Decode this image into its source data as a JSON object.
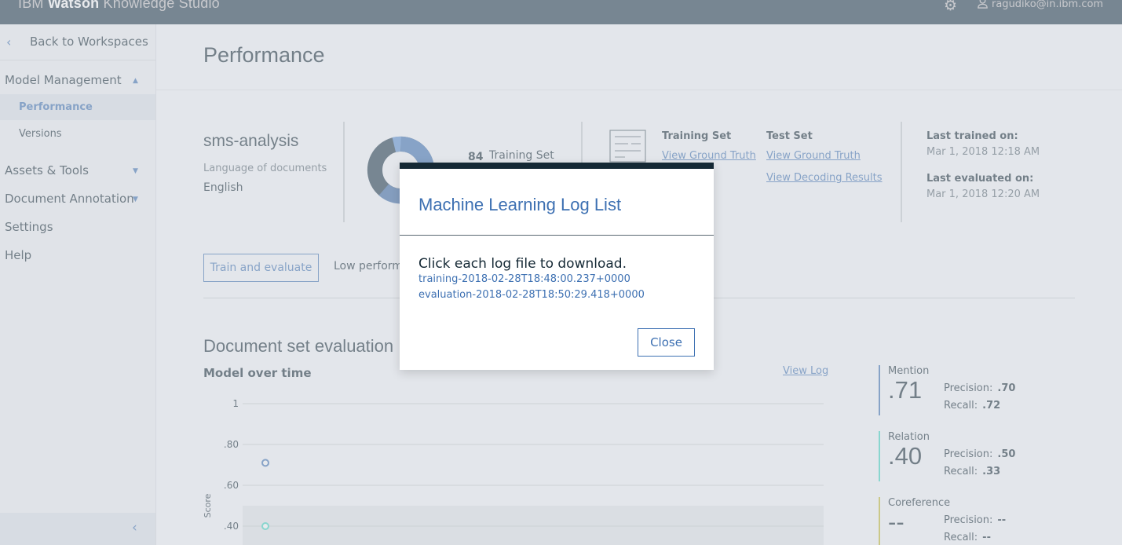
{
  "app": {
    "brand_prefix": "IBM ",
    "brand_bold": "Watson",
    "brand_suffix": " Knowledge Studio",
    "user": "ragudiko@in.ibm.com"
  },
  "sidebar": {
    "back_label": "Back to Workspaces",
    "model_management": "Model Management",
    "performance": "Performance",
    "versions": "Versions",
    "assets_tools": "Assets & Tools",
    "document_annotation": "Document Annotation",
    "settings": "Settings",
    "help": "Help"
  },
  "page": {
    "title": "Performance"
  },
  "project": {
    "name": "sms-analysis",
    "language_label": "Language of documents",
    "language": "English"
  },
  "summary": {
    "training_count": "84",
    "training_label": "Training Set"
  },
  "sets": {
    "training_title": "Training Set",
    "training_link": "View Ground Truth",
    "test_title": "Test Set",
    "test_link1": "View Ground Truth",
    "test_link2": "View Decoding Results"
  },
  "meta": {
    "last_trained_label": "Last trained on:",
    "last_trained_value": "Mar 1, 2018 12:18 AM",
    "last_evaluated_label": "Last evaluated on:",
    "last_evaluated_value": "Mar 1, 2018 12:20 AM"
  },
  "actions": {
    "train_button": "Train and evaluate",
    "low_perf_text": "Low performa"
  },
  "evaluation": {
    "section_title": "Document set evaluation",
    "chart_title": "Model over time",
    "view_log": "View Log"
  },
  "chart_data": {
    "type": "scatter",
    "title": "Model over time",
    "xlabel": "",
    "ylabel": "Score",
    "y_ticks": [
      "1",
      ".80",
      ".60",
      ".40"
    ],
    "ylim": [
      0.4,
      1
    ],
    "series": [
      {
        "name": "Mention",
        "x": [
          1
        ],
        "y": [
          0.71
        ],
        "color": "#3d70b2"
      },
      {
        "name": "Relation",
        "x": [
          1
        ],
        "y": [
          0.4
        ],
        "color": "#41d6c3"
      }
    ]
  },
  "metrics": [
    {
      "name": "Mention",
      "value": ".71",
      "precision": ".70",
      "recall": ".72",
      "color": "#3d70b2"
    },
    {
      "name": "Relation",
      "value": ".40",
      "precision": ".50",
      "recall": ".33",
      "color": "#41d6c3"
    },
    {
      "name": "Coreference",
      "value": "--",
      "precision": "--",
      "recall": "--",
      "color": "#c4bb35"
    }
  ],
  "metric_labels": {
    "precision": "Precision:",
    "recall": "Recall:"
  },
  "modal": {
    "title": "Machine Learning Log List",
    "instruction": "Click each log file to download.",
    "logs": [
      "training-2018-02-28T18:48:00.237+0000",
      "evaluation-2018-02-28T18:50:29.418+0000"
    ],
    "close_label": "Close"
  }
}
